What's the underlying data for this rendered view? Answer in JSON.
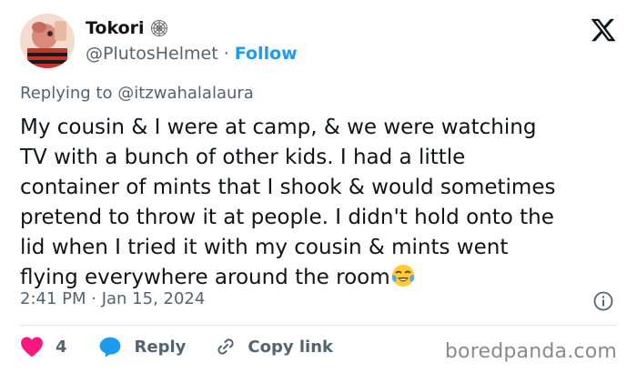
{
  "author": {
    "display_name": "Tokori",
    "handle": "@PlutosHelmet",
    "separator": "·",
    "follow_label": "Follow"
  },
  "reply_context": {
    "prefix": "Replying to",
    "mention": "@itzwahalalaura"
  },
  "tweet": {
    "lines": [
      "My cousin & I were at camp, & we were watching",
      "TV with a bunch of other kids. I had a little",
      "container of mints that I shook & would sometimes",
      "pretend to throw it at people. I didn't hold onto the",
      "lid when I tried it with my cousin & mints went",
      "flying everywhere around the room"
    ],
    "emoji": "face-with-tears-of-joy",
    "timestamp": "2:41 PM · Jan 15, 2024"
  },
  "actions": {
    "like_count": "4",
    "reply_label": "Reply",
    "copy_label": "Copy link"
  },
  "watermark": "boredpanda.com",
  "colors": {
    "text": "#0f1419",
    "muted": "#536471",
    "link": "#1d9bf0",
    "heart": "#f91880",
    "reply_bubble": "#1d9bf0"
  },
  "icons": [
    "spiderweb-icon",
    "x-logo-icon",
    "info-icon",
    "heart-icon",
    "reply-icon",
    "link-icon"
  ]
}
